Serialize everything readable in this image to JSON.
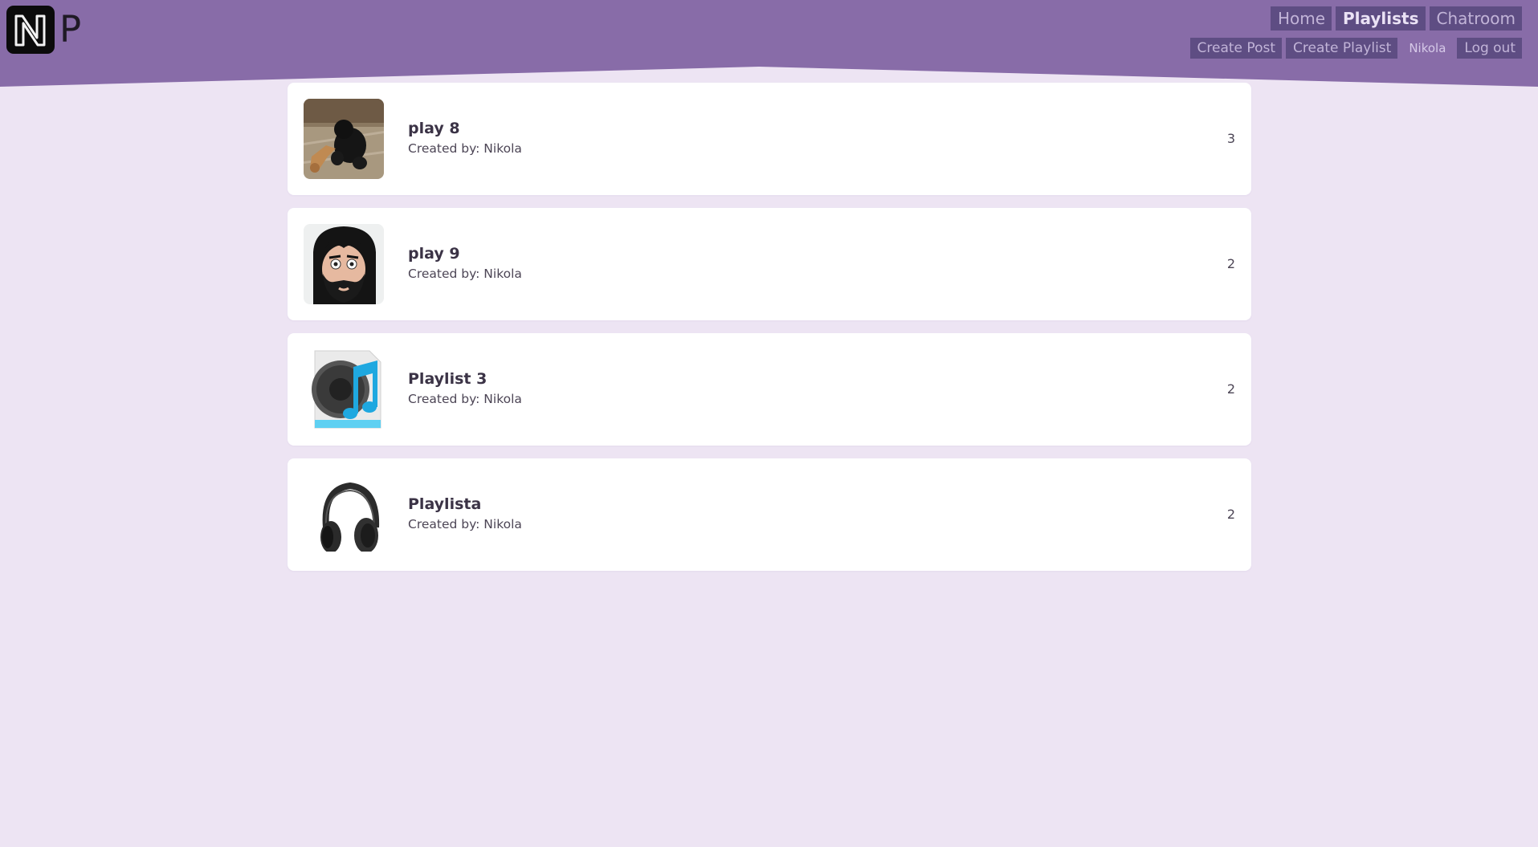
{
  "header": {
    "logo_letter": "P",
    "nav": [
      {
        "label": "Home"
      },
      {
        "label": "Playlists"
      },
      {
        "label": "Chatroom"
      }
    ],
    "actions": {
      "create_post": "Create Post",
      "create_playlist": "Create Playlist",
      "user": "Nikola",
      "logout": "Log out"
    }
  },
  "playlists": [
    {
      "title": "play 8",
      "creator": "Created by: Nikola",
      "count": "3",
      "thumbnail": "dog-photo"
    },
    {
      "title": "play 9",
      "creator": "Created by: Nikola",
      "count": "2",
      "thumbnail": "bearded-avatar"
    },
    {
      "title": "Playlist 3",
      "creator": "Created by: Nikola",
      "count": "2",
      "thumbnail": "speaker-music-icon"
    },
    {
      "title": "Playlista",
      "creator": "Created by: Nikola",
      "count": "2",
      "thumbnail": "headphones"
    }
  ],
  "colors": {
    "header": "#886ca8",
    "background": "#ede4f3",
    "nav_button": "#5e4d83",
    "card": "#ffffff"
  }
}
